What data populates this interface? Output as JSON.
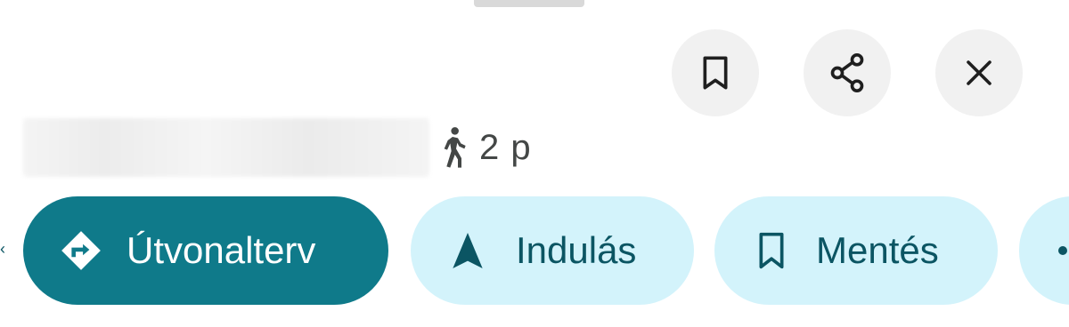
{
  "header": {
    "save_icon": "bookmark-icon",
    "share_icon": "share-icon",
    "close_icon": "close-icon"
  },
  "place": {
    "travel_mode_icon": "walk-icon",
    "travel_time": "2 p"
  },
  "actions": {
    "directions": {
      "label": "Útvonalterv",
      "icon": "directions-icon"
    },
    "start": {
      "label": "Indulás",
      "icon": "navigation-arrow-icon"
    },
    "save": {
      "label": "Mentés",
      "icon": "bookmark-icon"
    },
    "more": {
      "icon": "more-icon"
    }
  },
  "colors": {
    "primary": "#0f7a8a",
    "chip_bg": "#d3f3fb",
    "chip_text": "#0b5563",
    "round_button_bg": "#f1f1f1"
  }
}
